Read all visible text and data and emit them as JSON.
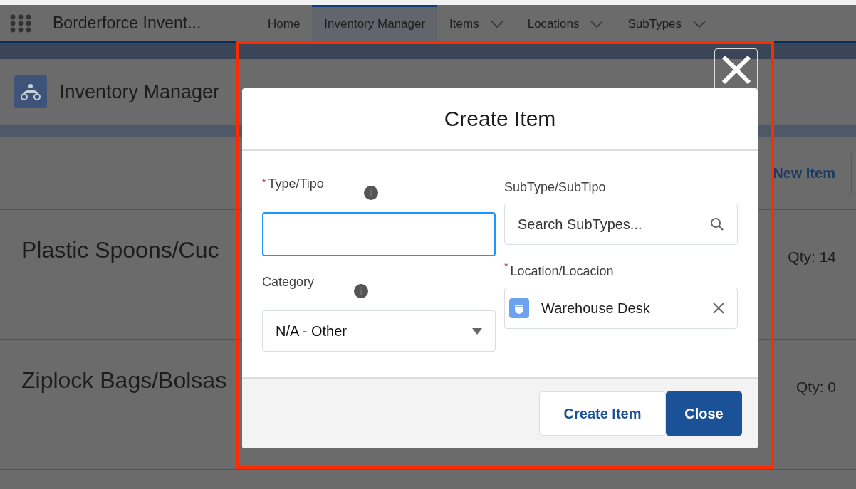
{
  "app_bar": {
    "app_name": "Borderforce Invent...",
    "tabs": [
      {
        "label": "Home",
        "selected": false,
        "has_menu": false
      },
      {
        "label": "Inventory Manager",
        "selected": true,
        "has_menu": false
      },
      {
        "label": "Items",
        "selected": false,
        "has_menu": true
      },
      {
        "label": "Locations",
        "selected": false,
        "has_menu": true
      },
      {
        "label": "SubTypes",
        "selected": false,
        "has_menu": true
      }
    ]
  },
  "page_header": {
    "title": "Inventory Manager"
  },
  "toolbar": {
    "new_button": "New Item"
  },
  "items": [
    {
      "name": "Plastic Spoons/Cuc",
      "qty": "Qty: 14"
    },
    {
      "name": "Ziplock Bags/Bolsas",
      "qty": "Qty: 0"
    }
  ],
  "modal": {
    "title": "Create Item",
    "left_fields": [
      {
        "kind": "text",
        "required_mark": "*",
        "label": "Type/Tipo",
        "info": true,
        "focused": true
      },
      {
        "kind": "select",
        "label": "Category",
        "info": true,
        "value": "N/A - Other"
      }
    ],
    "right_fields": [
      {
        "kind": "search",
        "label": "SubType/SubTipo",
        "info": false,
        "placeholder": "Search SubTypes..."
      },
      {
        "kind": "lookup",
        "required_mark": "*",
        "label": "Location/Locacion",
        "info": false,
        "value": "Warehouse Desk"
      }
    ],
    "buttons": [
      {
        "label": "Create Item",
        "kind": "neutral"
      },
      {
        "label": "Close",
        "kind": "brand"
      }
    ]
  }
}
